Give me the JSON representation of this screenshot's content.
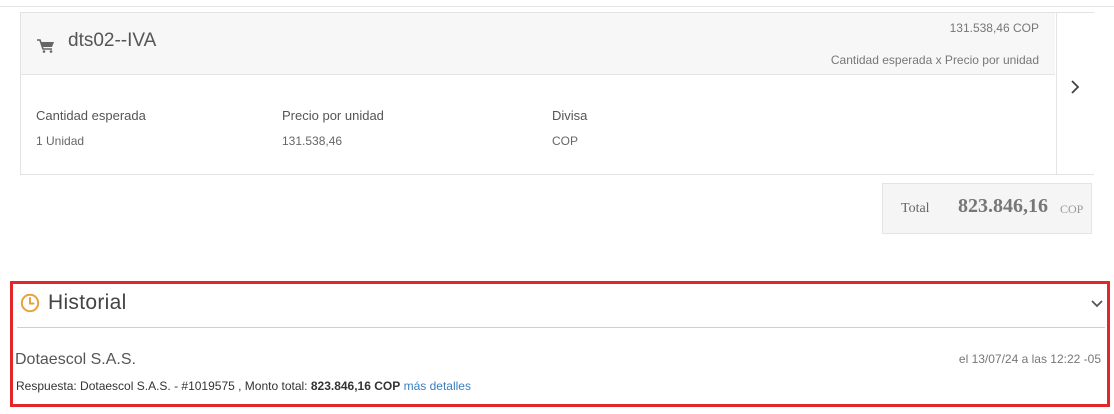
{
  "item": {
    "name": "dts02--IVA",
    "amount": "131.538,46 COP",
    "formula": "Cantidad esperada x Precio por unidad",
    "details": [
      {
        "label": "Cantidad esperada",
        "value": "1 Unidad"
      },
      {
        "label": "Precio por unidad",
        "value": "131.538,46"
      },
      {
        "label": "Divisa",
        "value": "COP"
      }
    ]
  },
  "total": {
    "label": "Total",
    "amount": "823.846,16",
    "currency": "COP"
  },
  "historial": {
    "title": "Historial",
    "entry": {
      "company": "Dotaescol S.A.S.",
      "timestamp": "el 13/07/24 a las 12:22 -05",
      "response_prefix": "Respuesta: Dotaescol S.A.S. - #1019575 , Monto total: ",
      "response_amount": "823.846,16 COP",
      "more_link": "más detalles"
    }
  },
  "icons": {
    "cart": "cart-icon",
    "expand": "chevron-right-icon",
    "history": "clock-icon",
    "collapse": "chevron-down-icon"
  },
  "colors": {
    "highlight_border": "#e3262b",
    "clock_accent": "#e8a23a",
    "link": "#3a7fc0"
  }
}
